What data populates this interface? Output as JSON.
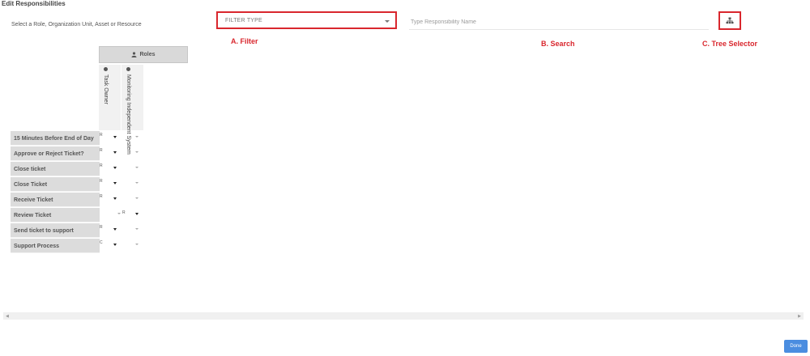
{
  "page": {
    "title": "Edit Responsibilities",
    "subtitle": "Select a Role, Organization Unit, Asset or Resource"
  },
  "filter": {
    "label": "FILTER TYPE"
  },
  "search": {
    "placeholder": "Type Responsibility Name"
  },
  "tree_selector": {
    "icon": "sitemap-icon"
  },
  "annotations": {
    "filter": "A. Filter",
    "search": "B. Search",
    "tree": "C. Tree Selector"
  },
  "matrix": {
    "group_header": "Roles",
    "columns": [
      "Task Owner",
      "Monitoring Independent System"
    ],
    "rows": [
      {
        "label": "15 Minutes Before End of Day",
        "values": [
          "R",
          ""
        ]
      },
      {
        "label": "Approve or Reject Ticket?",
        "values": [
          "R",
          ""
        ]
      },
      {
        "label": "Close ticket",
        "values": [
          "R",
          ""
        ]
      },
      {
        "label": "Close Ticket",
        "values": [
          "R",
          ""
        ]
      },
      {
        "label": "Receive Ticket",
        "values": [
          "R",
          ""
        ]
      },
      {
        "label": "Review Ticket",
        "values": [
          "",
          "R"
        ]
      },
      {
        "label": "Send ticket to support",
        "values": [
          "R",
          ""
        ]
      },
      {
        "label": "Support Process",
        "values": [
          "C",
          ""
        ]
      }
    ]
  },
  "done_label": "Done",
  "colors": {
    "accent_red": "#d9272e",
    "done_blue": "#4a8de0"
  }
}
